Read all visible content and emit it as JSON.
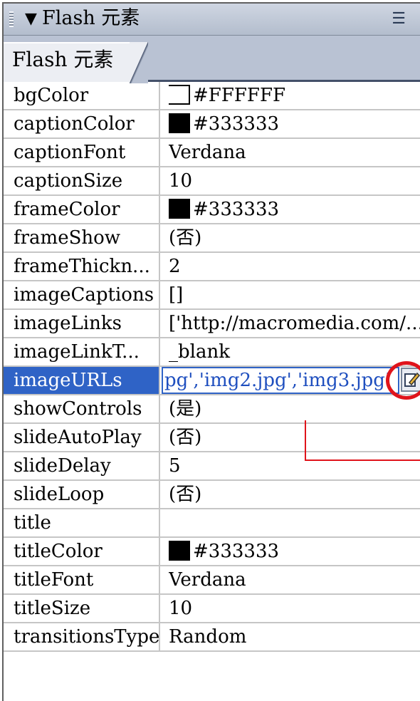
{
  "panel": {
    "title": "Flash 元素",
    "collapse_glyph": "▼",
    "options_icon": "options-menu-icon"
  },
  "tab": {
    "label": "Flash 元素"
  },
  "selected_row": 10,
  "colors": {
    "selection": "#2f63c6",
    "highlight": "#e0141b"
  },
  "properties": [
    {
      "name": "bgColor",
      "value": "#FFFFFF",
      "swatch": "#FFFFFF"
    },
    {
      "name": "captionColor",
      "value": "#333333",
      "swatch": "#000000"
    },
    {
      "name": "captionFont",
      "value": "Verdana"
    },
    {
      "name": "captionSize",
      "value": "10"
    },
    {
      "name": "frameColor",
      "value": "#333333",
      "swatch": "#000000"
    },
    {
      "name": "frameShow",
      "value": "(否)"
    },
    {
      "name": "frameThickn...",
      "value": "2"
    },
    {
      "name": "imageCaptions",
      "value": "[]"
    },
    {
      "name": "imageLinks",
      "value": "['http://macromedia.com/..."
    },
    {
      "name": "imageLinkT...",
      "value": "_blank"
    },
    {
      "name": "imageURLs",
      "value": "pg','img2.jpg','img3.jpg'"
    },
    {
      "name": "showControls",
      "value": "(是)"
    },
    {
      "name": "slideAutoPlay",
      "value": "(否)"
    },
    {
      "name": "slideDelay",
      "value": "5"
    },
    {
      "name": "slideLoop",
      "value": "(否)"
    },
    {
      "name": "title",
      "value": ""
    },
    {
      "name": "titleColor",
      "value": "#333333",
      "swatch": "#000000"
    },
    {
      "name": "titleFont",
      "value": "Verdana"
    },
    {
      "name": "titleSize",
      "value": "10"
    },
    {
      "name": "transitionsType",
      "value": "Random"
    }
  ]
}
